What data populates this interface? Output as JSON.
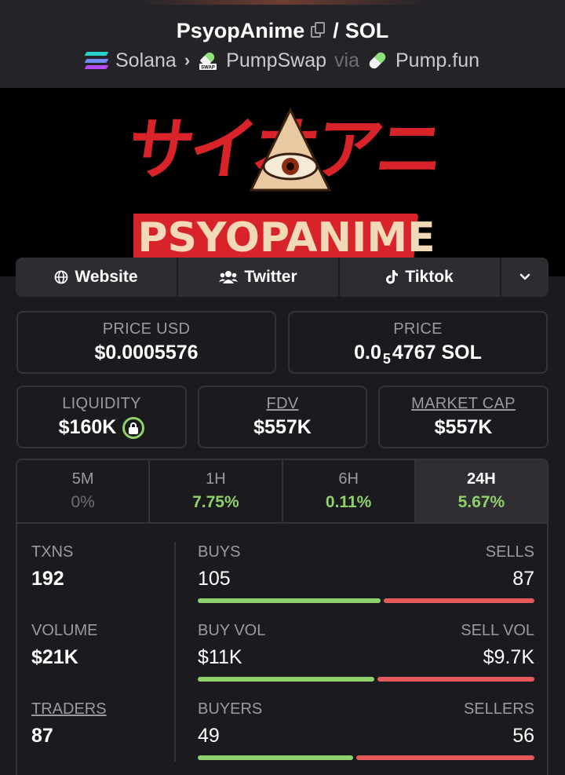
{
  "header": {
    "token": "PsyopAnime",
    "separator": "/",
    "quote": "SOL",
    "chain": "Solana",
    "dex": "PumpSwap",
    "via": "via",
    "launchpad": "Pump.fun"
  },
  "banner": {
    "logo_text_jp": "サイオアニメ",
    "logo_text": "PSYOPANIME"
  },
  "links": [
    {
      "label": "Website",
      "icon": "globe-icon"
    },
    {
      "label": "Twitter",
      "icon": "users-icon"
    },
    {
      "label": "Tiktok",
      "icon": "tiktok-icon"
    }
  ],
  "prices": {
    "price_usd_label": "PRICE USD",
    "price_usd": "$0.0005576",
    "price_label": "PRICE",
    "price_sol_prefix": "0.0",
    "price_sol_sub": "5",
    "price_sol_rest": "4767 SOL"
  },
  "metrics": {
    "liquidity_label": "LIQUIDITY",
    "liquidity": "$160K",
    "fdv_label": "FDV",
    "fdv": "$557K",
    "mcap_label": "MARKET CAP",
    "mcap": "$557K"
  },
  "tabs": [
    {
      "label": "5M",
      "value": "0%"
    },
    {
      "label": "1H",
      "value": "7.75%"
    },
    {
      "label": "6H",
      "value": "0.11%"
    },
    {
      "label": "24H",
      "value": "5.67%"
    }
  ],
  "stats": {
    "txns_label": "TXNS",
    "txns": "192",
    "buys_label": "BUYS",
    "buys": "105",
    "sells_label": "SELLS",
    "sells": "87",
    "buys_fraction": 0.547,
    "volume_label": "VOLUME",
    "volume": "$21K",
    "buy_vol_label": "BUY VOL",
    "buy_vol": "$11K",
    "sell_vol_label": "SELL VOL",
    "sell_vol": "$9.7K",
    "buy_vol_fraction": 0.53,
    "traders_label": "TRADERS",
    "traders": "87",
    "buyers_label": "BUYERS",
    "buyers": "49",
    "sellers_label": "SELLERS",
    "sellers": "56",
    "buyers_fraction": 0.467
  },
  "colors": {
    "positive": "#8fd16a",
    "negative": "#e55b5b",
    "accent_red": "#d8232a"
  }
}
